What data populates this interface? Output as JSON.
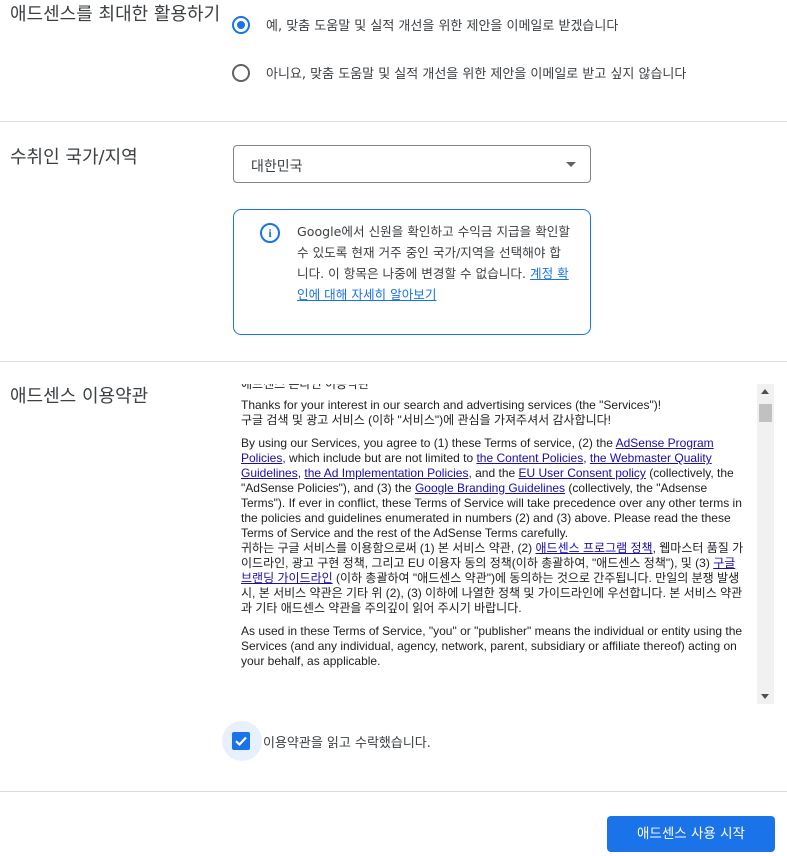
{
  "optimize": {
    "title": "애드센스를 최대한 활용하기",
    "options": [
      {
        "label": "예, 맞춤 도움말 및 실적 개선을 위한 제안을 이메일로 받겠습니다",
        "selected": true
      },
      {
        "label": "아니요, 맞춤 도움말 및 실적 개선을 위한 제안을 이메일로 받고 싶지 않습니다",
        "selected": false
      }
    ]
  },
  "country": {
    "title": "수취인 국가/지역",
    "selected": "대한민국",
    "info_text": "Google에서 신원을 확인하고 수익금 지급을 확인할 수 있도록 현재 거주 중인 국가/지역을 선택해야 합니다. 이 항목은 나중에 변경할 수 없습니다. ",
    "info_link": "계정 확인에 대해 자세히 알아보기"
  },
  "terms": {
    "title": "애드센스 이용약관",
    "partial_top_line": "애드센스 온라인 이용약관",
    "intro_en": "Thanks for your interest in our search and advertising services (the \"Services\")!",
    "intro_ko": "구글 검색 및 광고 서비스 (이하 \"서비스\")에 관심을 가져주셔서 감사합니다!",
    "p2": {
      "t1": "By using our Services, you agree to (1) these Terms of service, (2) the ",
      "l1": "AdSense Program Policies",
      "t2": ", which include but are not limited to ",
      "l2": "the Content Policies",
      "t3": ", ",
      "l3": "the Webmaster Quality Guidelines",
      "t4": ", ",
      "l4": "the Ad Implementation Policies",
      "t5": ", and the ",
      "l5": "EU User Consent policy",
      "t6": " (collectively, the \"AdSense Policies\"), and (3) the ",
      "l6": "Google Branding Guidelines",
      "t7": " (collectively, the \"Adsense Terms\"). If ever in conflict, these Terms of Service will take precedence over any other terms in the policies and guidelines enumerated in numbers (2) and (3) above. Please read the these Terms of Service and the rest of the AdSense Terms carefully."
    },
    "p2_ko": {
      "t1": "귀하는 구글 서비스를 이용함으로써 (1) 본 서비스 약관, (2) ",
      "l1": "애드센스 프로그램 정책",
      "t2": ", 웹마스터 품질 가이드라인, 광고 구현 정책, 그리고 EU 이용자 동의 정책(이하 총괄하여, \"애드센스 정책\"), 및 (3) ",
      "l2": "구글 브랜딩 가이드라인",
      "t3": " (이하 총괄하여 \"애드센스 약관\")에 동의하는 것으로 간주됩니다. 만일의 분쟁 발생시, 본 서비스 약관은 기타 위 (2), (3) 이하에 나열한 정책 및 가이드라인에 우선합니다. 본 서비스 약관과 기타 애드센스 약관을 주의깊이 읽어 주시기 바랍니다."
    },
    "p3": "As used in these Terms of Service, \"you\" or \"publisher\" means the individual or entity using the Services (and any individual, agency, network, parent, subsidiary or affiliate thereof) acting on your behalf, as applicable."
  },
  "agree": {
    "label": "이용약관을 읽고 수락했습니다.",
    "checked": true
  },
  "submit": {
    "label": "애드센스 사용 시작"
  },
  "colors": {
    "accent": "#1a73e8",
    "divider": "#dadce0",
    "text": "#3c4043"
  }
}
